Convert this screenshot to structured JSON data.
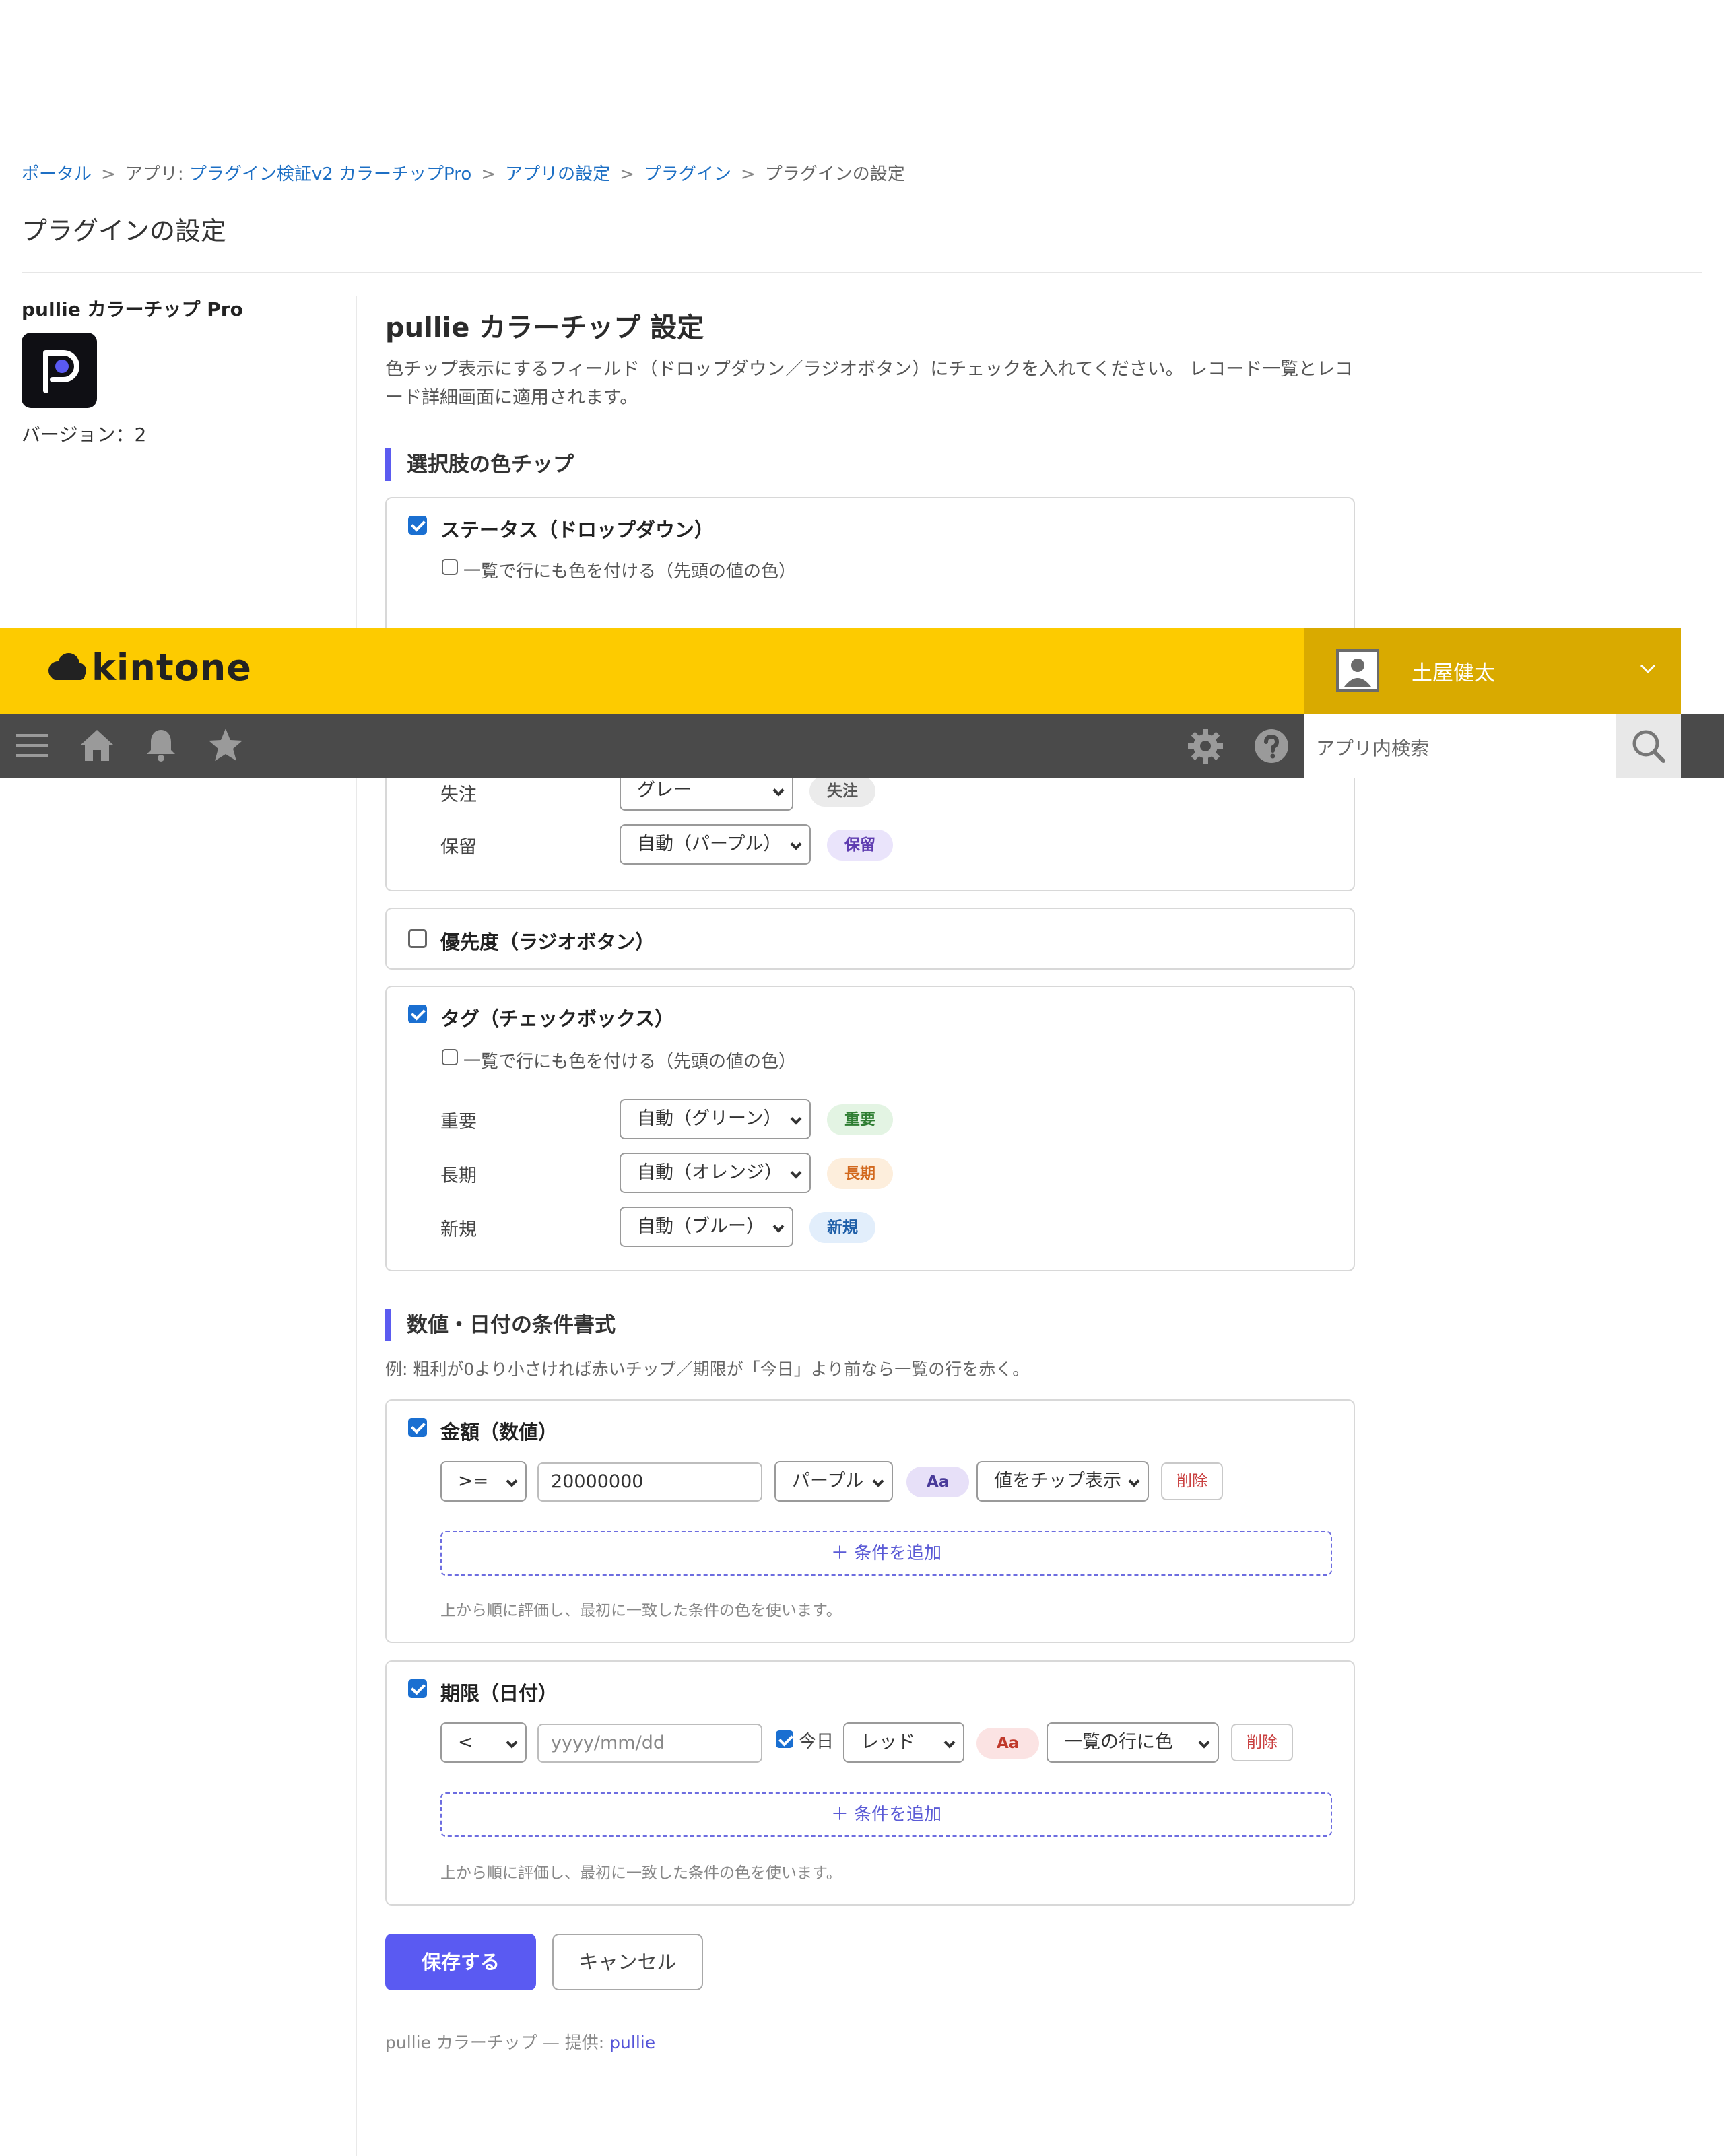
{
  "breadcrumb": {
    "portal": "ポータル",
    "sep": ">",
    "app_prefix": "アプリ:",
    "app_name": "プラグイン検証v2 カラーチップPro",
    "app_settings": "アプリの設定",
    "plugins": "プラグイン",
    "current": "プラグインの設定"
  },
  "page_title": "プラグインの設定",
  "plugin": {
    "name": "pullie カラーチップ Pro",
    "version": "バージョン：2"
  },
  "header": {
    "logo": "kintone",
    "user": "土屋健太",
    "search_placeholder": "アプリ内検索"
  },
  "main": {
    "title": "pullie カラーチップ 設定",
    "description": "色チップ表示にするフィールド（ドロップダウン／ラジオボタン）にチェックを入れてください。 レコード一覧とレコード詳細画面に適用されます。"
  },
  "section_choices": {
    "heading": "選択肢の色チップ",
    "status": {
      "label": "ステータス（ドロップダウン）",
      "row_color_label": "一覧で行にも色を付ける（先頭の値の色）",
      "options": [
        {
          "name": "失注",
          "color": "グレー",
          "chip": "失注"
        },
        {
          "name": "保留",
          "color": "自動（パープル）",
          "chip": "保留"
        }
      ]
    },
    "priority": {
      "label": "優先度（ラジオボタン）"
    },
    "tags": {
      "label": "タグ（チェックボックス）",
      "row_color_label": "一覧で行にも色を付ける（先頭の値の色）",
      "options": [
        {
          "name": "重要",
          "color": "自動（グリーン）",
          "chip": "重要"
        },
        {
          "name": "長期",
          "color": "自動（オレンジ）",
          "chip": "長期"
        },
        {
          "name": "新規",
          "color": "自動（ブルー）",
          "chip": "新規"
        }
      ]
    }
  },
  "section_conditions": {
    "heading": "数値・日付の条件書式",
    "note": "例: 粗利が0より小さければ赤いチップ／期限が「今日」より前なら一覧の行を赤く。",
    "amount": {
      "label": "金額（数値）",
      "operator": ">=",
      "value": "20000000",
      "color": "パープル",
      "preview": "Aa",
      "mode": "値をチップ表示",
      "delete": "削除",
      "add": "＋ 条件を追加",
      "hint": "上から順に評価し、最初に一致した条件の色を使います。"
    },
    "deadline": {
      "label": "期限（日付）",
      "operator": "<",
      "placeholder": "yyyy/mm/dd",
      "today_label": "今日",
      "color": "レッド",
      "preview": "Aa",
      "mode": "一覧の行に色",
      "delete": "削除",
      "add": "＋ 条件を追加",
      "hint": "上から順に評価し、最初に一致した条件の色を使います。"
    }
  },
  "actions": {
    "save": "保存する",
    "cancel": "キャンセル"
  },
  "footer": {
    "text": "pullie カラーチップ — 提供:",
    "link": "pullie"
  },
  "colors": {
    "accent": "#5a5af2",
    "header_yellow": "#fdcb00",
    "header_dark": "#4a4a4a",
    "link": "#1d6fc4",
    "checkbox": "#1a6fd1"
  }
}
